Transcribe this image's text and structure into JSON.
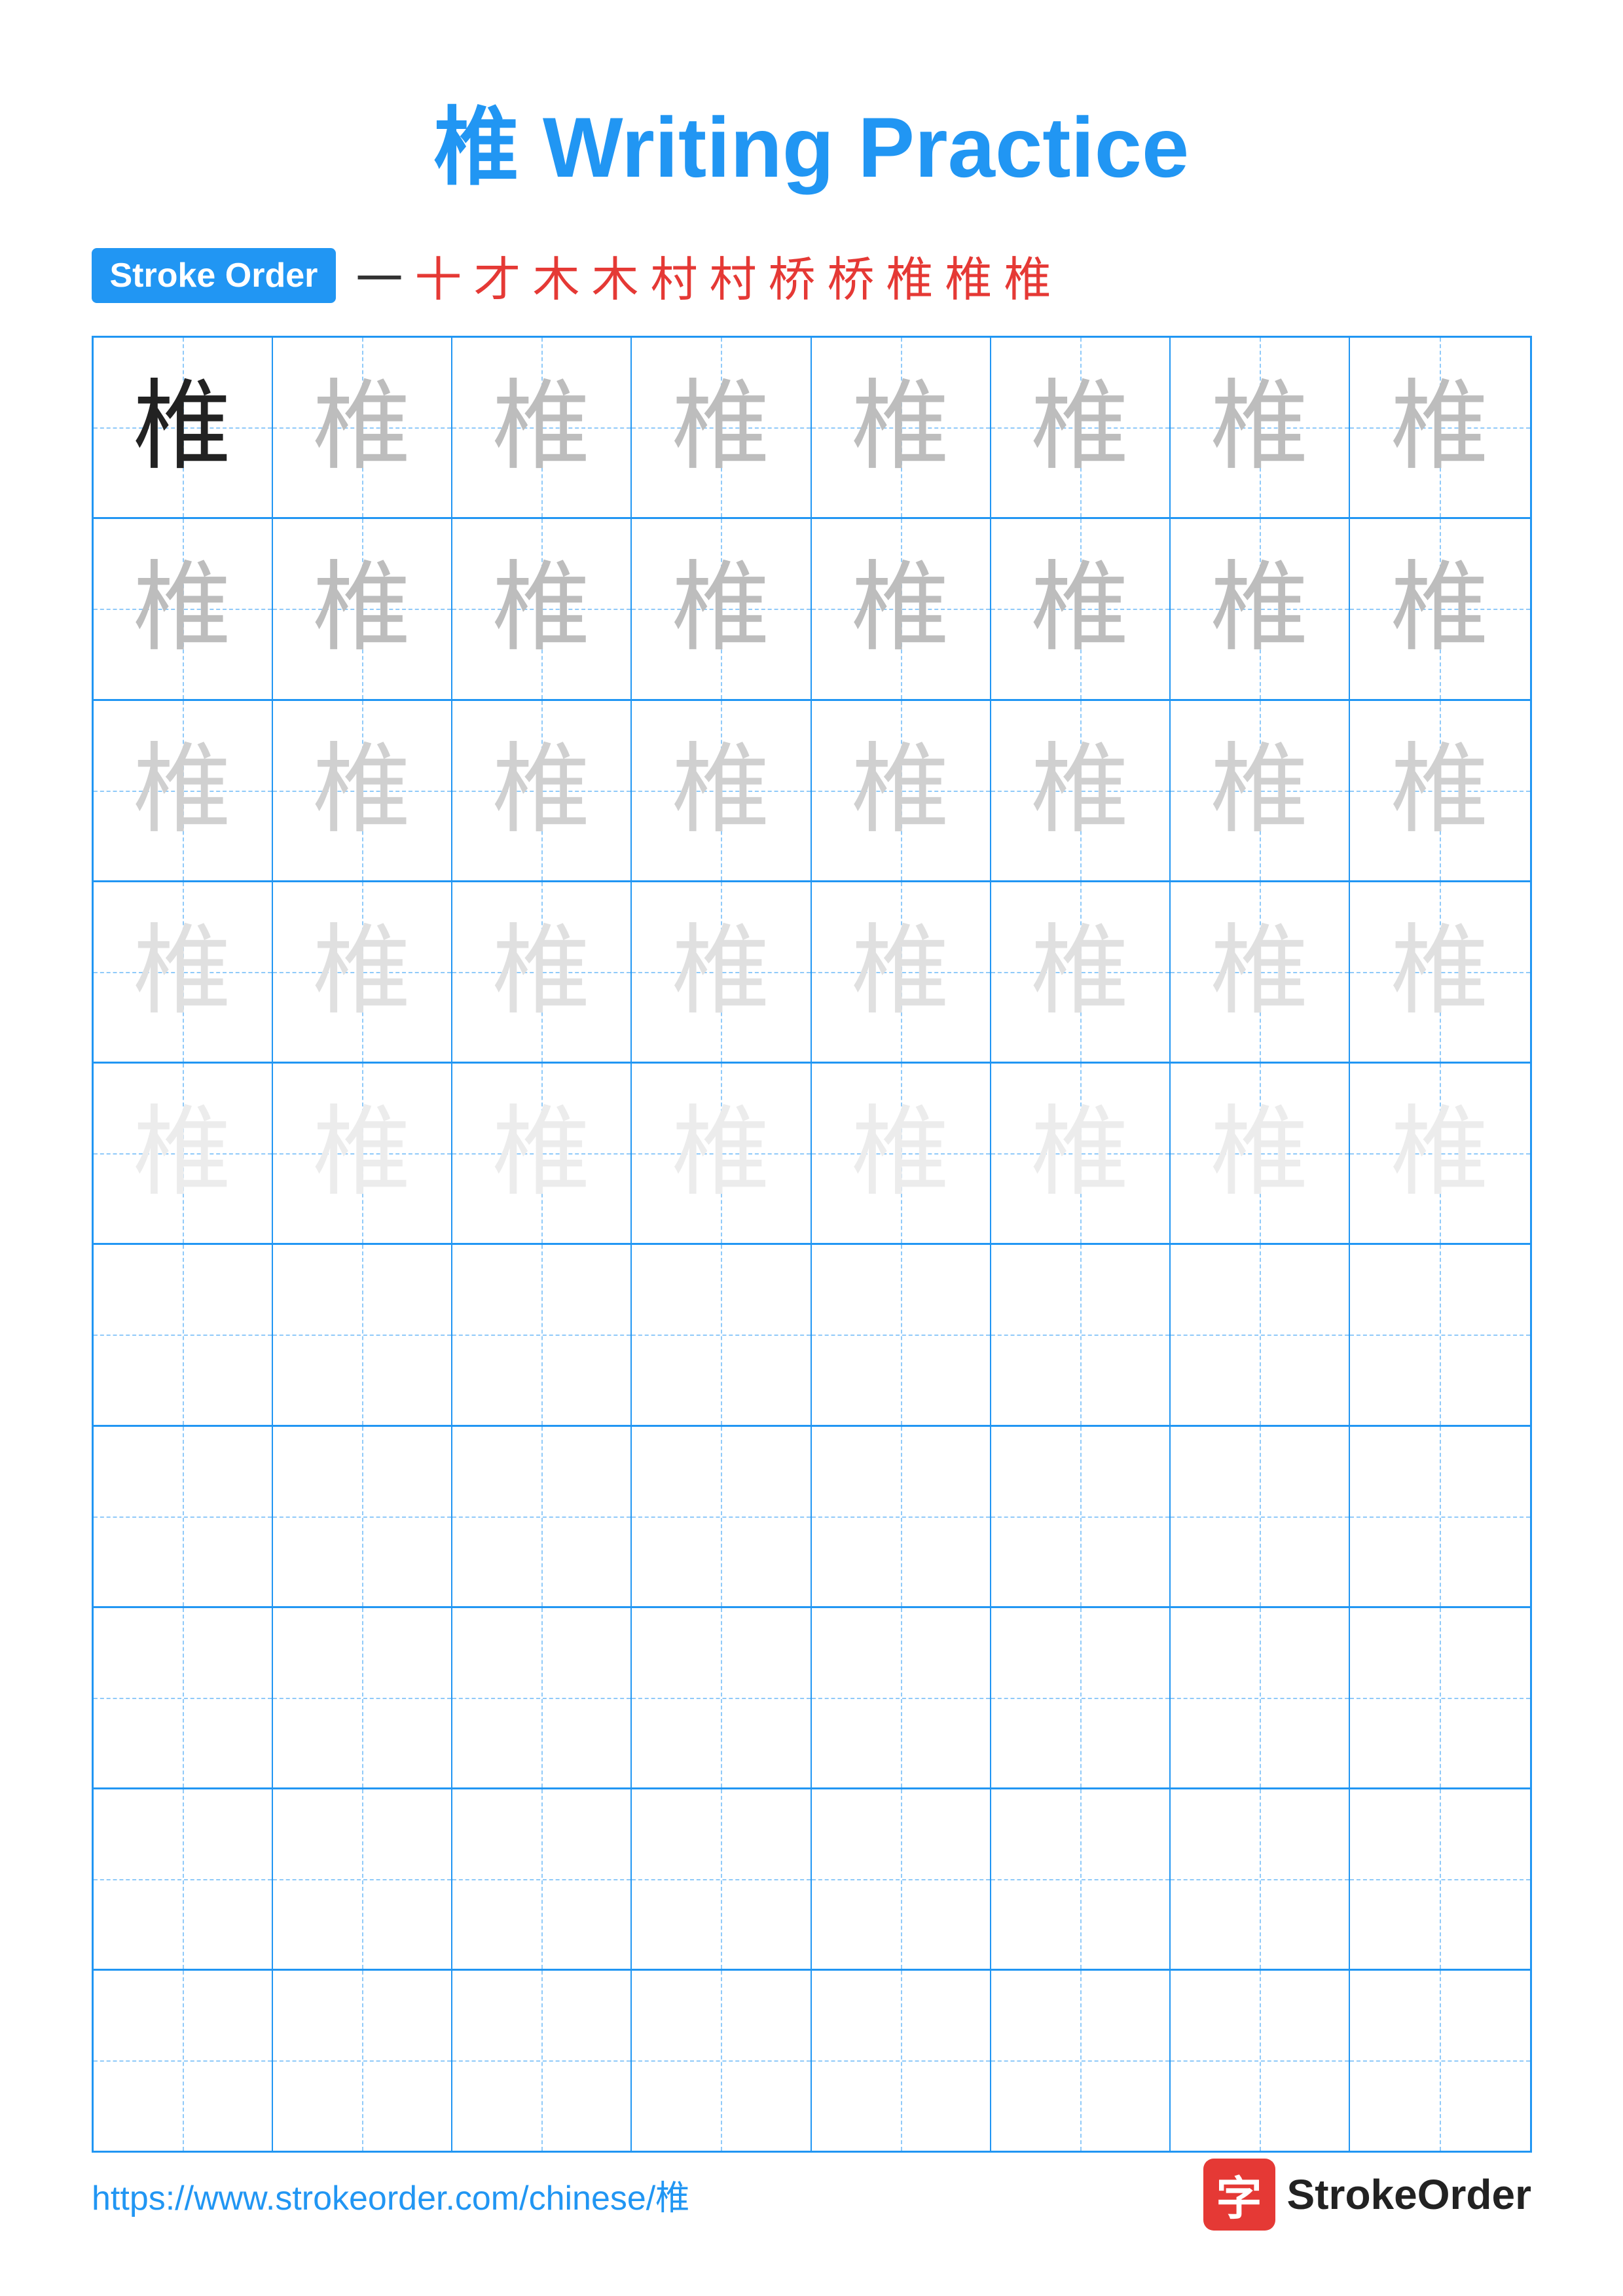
{
  "title": {
    "char": "椎",
    "text": "Writing Practice",
    "full": "椎 Writing Practice"
  },
  "stroke_order": {
    "badge_label": "Stroke Order",
    "strokes": [
      "一",
      "十",
      "才",
      "木",
      "木",
      "村",
      "村",
      "桥",
      "桥",
      "椎",
      "椎",
      "椎"
    ]
  },
  "grid": {
    "cols": 8,
    "char": "椎",
    "rows": [
      {
        "type": "dark-fade",
        "chars": [
          "dark",
          "light1",
          "light1",
          "light1",
          "light1",
          "light1",
          "light1",
          "light1"
        ]
      },
      {
        "type": "fade",
        "chars": [
          "light1",
          "light1",
          "light1",
          "light1",
          "light1",
          "light1",
          "light1",
          "light1"
        ]
      },
      {
        "type": "fade2",
        "chars": [
          "light2",
          "light2",
          "light2",
          "light2",
          "light2",
          "light2",
          "light2",
          "light2"
        ]
      },
      {
        "type": "fade3",
        "chars": [
          "light3",
          "light3",
          "light3",
          "light3",
          "light3",
          "light3",
          "light3",
          "light3"
        ]
      },
      {
        "type": "fade4",
        "chars": [
          "light4",
          "light4",
          "light4",
          "light4",
          "light4",
          "light4",
          "light4",
          "light4"
        ]
      },
      {
        "type": "empty"
      },
      {
        "type": "empty"
      },
      {
        "type": "empty"
      },
      {
        "type": "empty"
      },
      {
        "type": "empty"
      }
    ]
  },
  "footer": {
    "url": "https://www.strokeorder.com/chinese/椎",
    "logo_char": "字",
    "logo_text": "StrokeOrder"
  }
}
